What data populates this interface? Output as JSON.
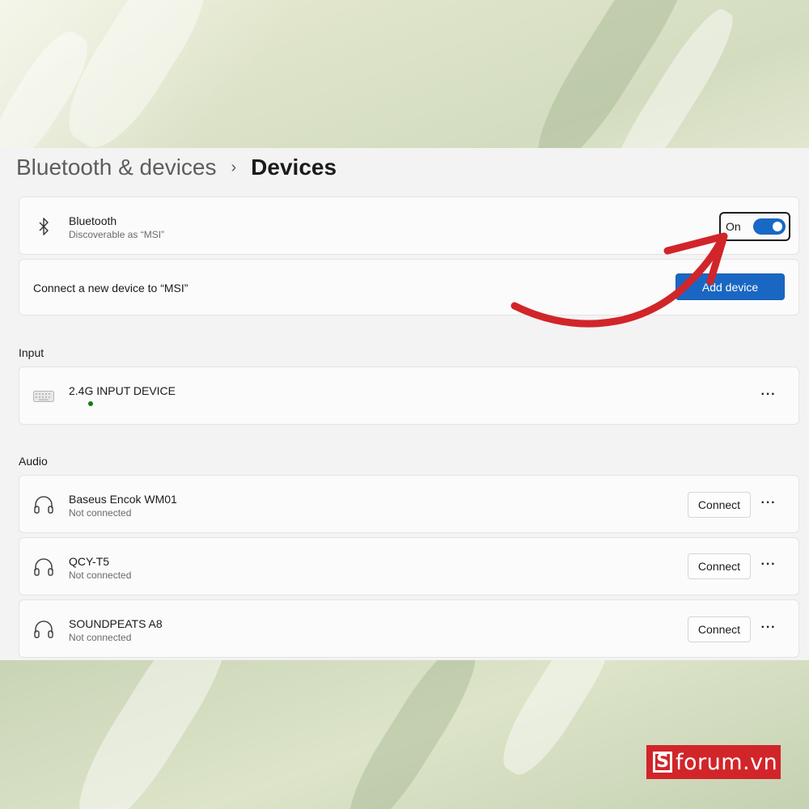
{
  "breadcrumb": {
    "parent": "Bluetooth & devices",
    "separator": "›",
    "current": "Devices"
  },
  "bluetooth": {
    "title": "Bluetooth",
    "subtitle": "Discoverable as “MSI”",
    "toggle_label": "On",
    "toggle_on": true
  },
  "connect_new": {
    "label": "Connect a new device to “MSI”",
    "button": "Add device"
  },
  "input_section": {
    "heading": "Input",
    "devices": [
      {
        "name": "2.4G INPUT DEVICE",
        "icon": "keyboard-icon",
        "connected": true
      }
    ]
  },
  "audio_section": {
    "heading": "Audio",
    "devices": [
      {
        "name": "Baseus Encok WM01",
        "status": "Not connected",
        "icon": "headphones-icon",
        "button": "Connect"
      },
      {
        "name": "QCY-T5",
        "status": "Not connected",
        "icon": "headphones-icon",
        "button": "Connect"
      },
      {
        "name": "SOUNDPEATS A8",
        "status": "Not connected",
        "icon": "headphones-icon",
        "button": "Connect"
      }
    ]
  },
  "more_label": "···",
  "watermark": {
    "letter": "S",
    "text": "forum.vn"
  },
  "colors": {
    "accent": "#1a67c3",
    "annotation_arrow": "#d1252a",
    "status_connected": "#107c10"
  }
}
